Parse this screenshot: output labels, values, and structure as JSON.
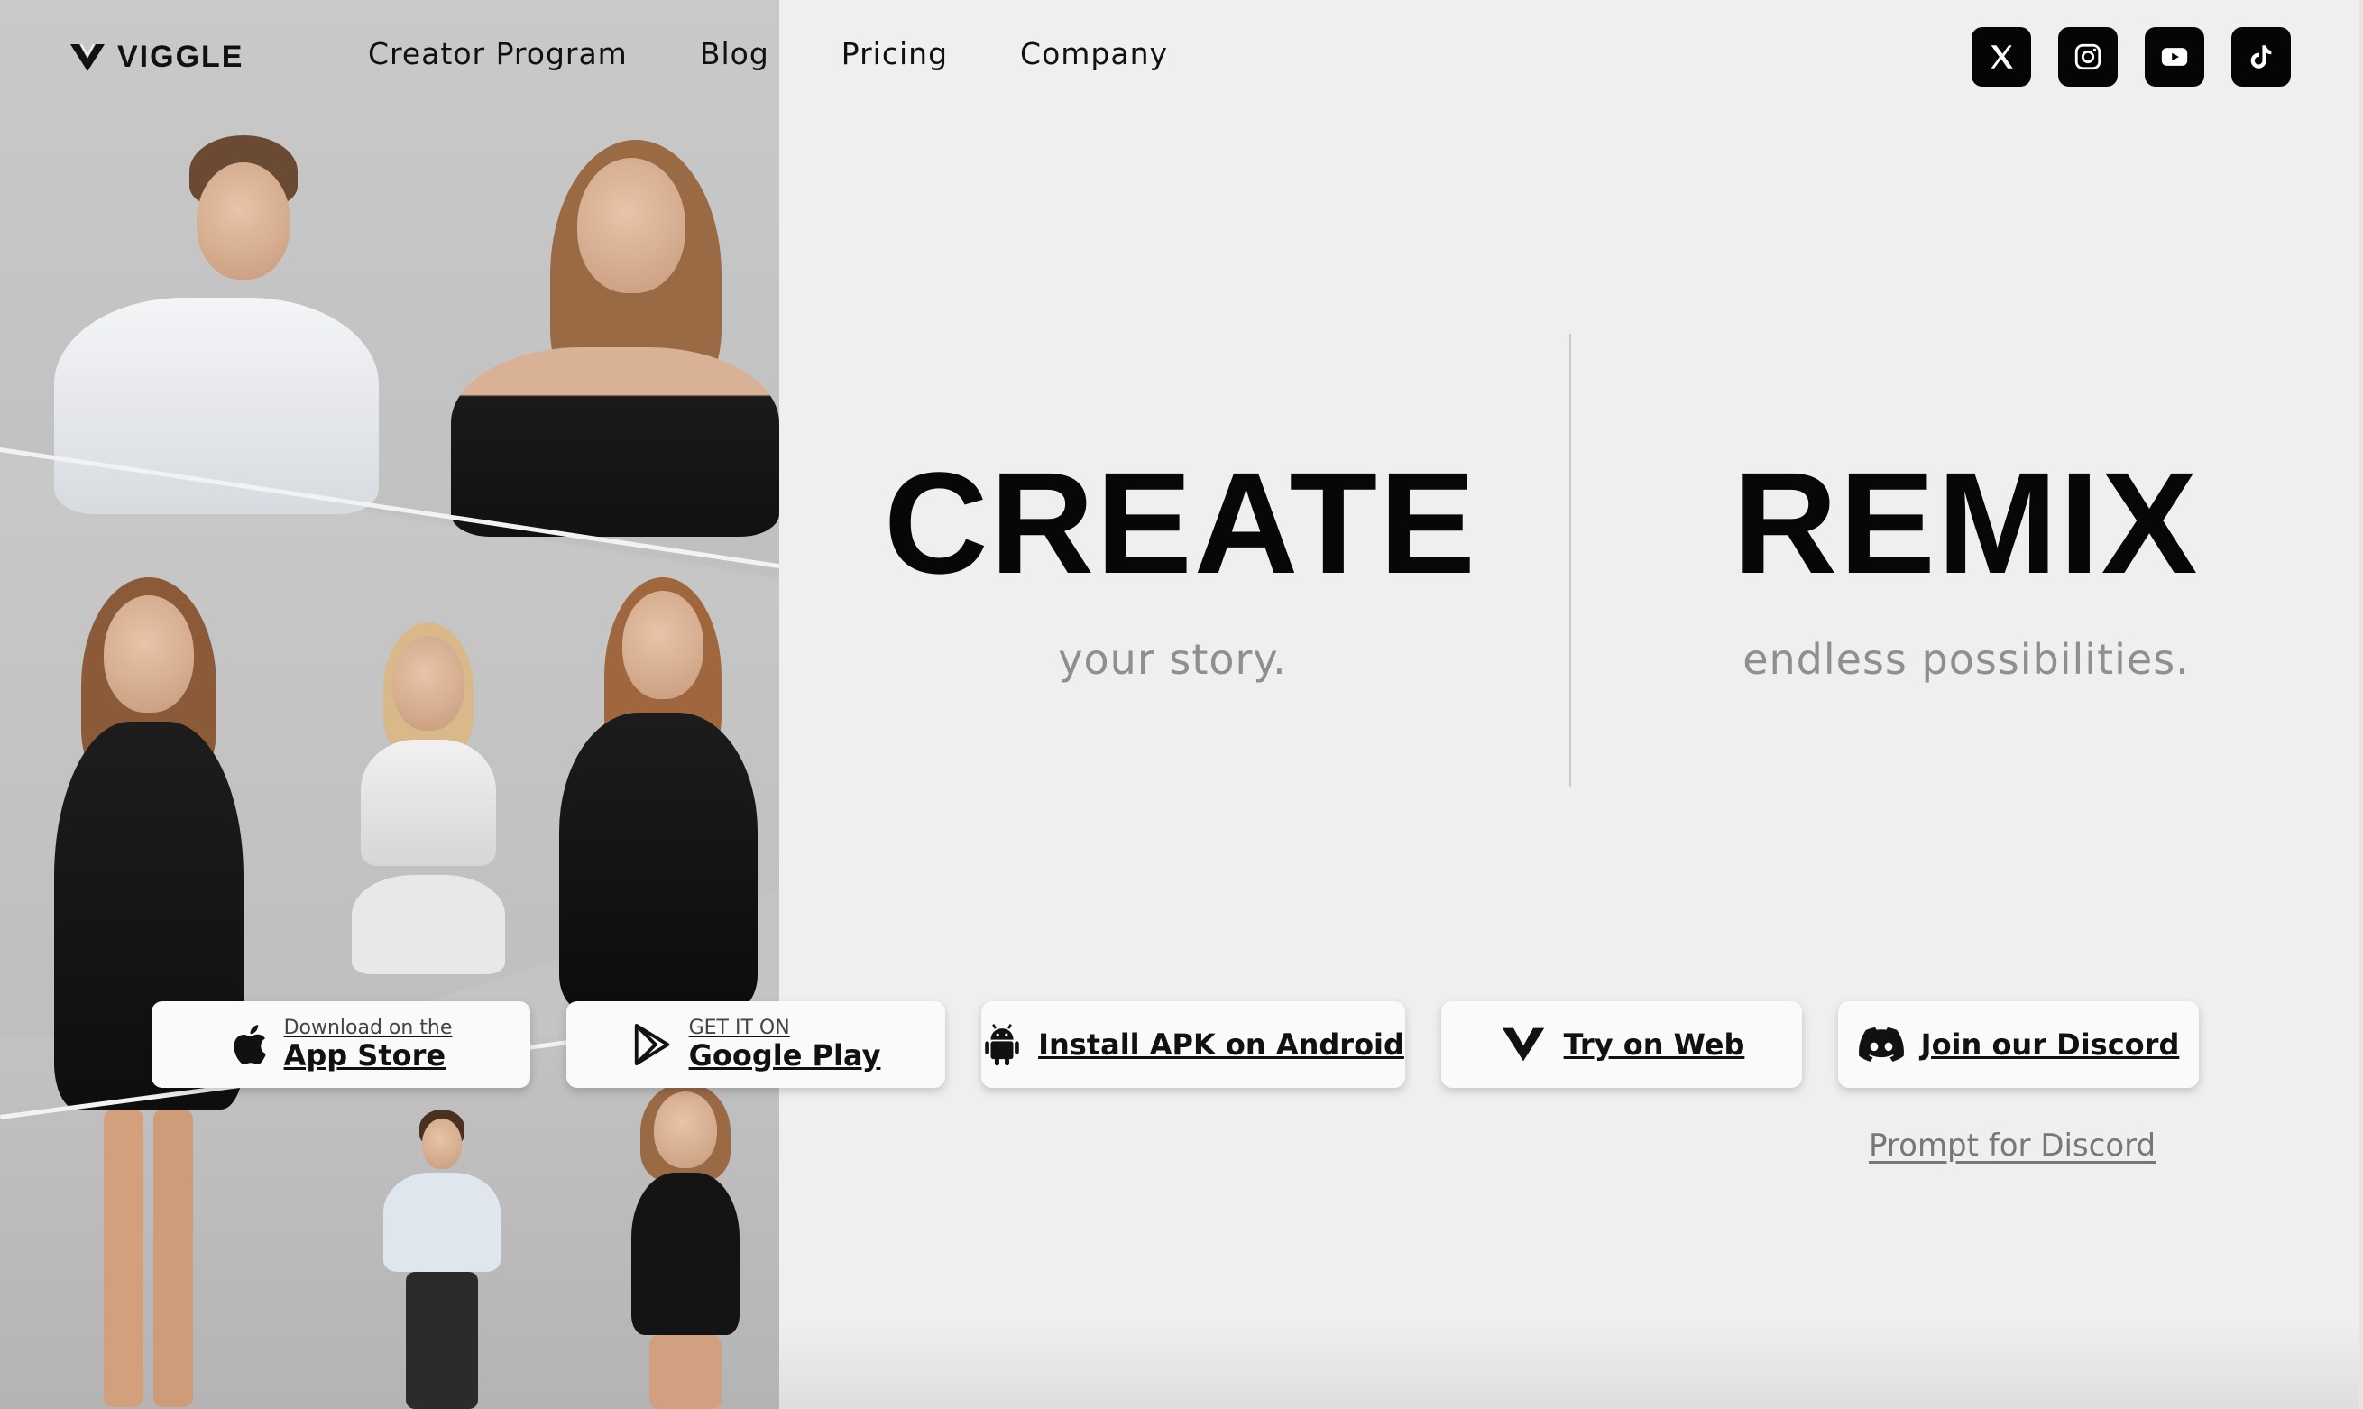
{
  "brand": {
    "name": "VIGGLE"
  },
  "nav": {
    "items": [
      {
        "label": "Creator Program"
      },
      {
        "label": "Blog"
      },
      {
        "label": "Pricing"
      },
      {
        "label": "Company"
      }
    ]
  },
  "socials": [
    {
      "icon": "x-icon",
      "label": "X"
    },
    {
      "icon": "instagram-icon",
      "label": "Instagram"
    },
    {
      "icon": "youtube-icon",
      "label": "YouTube"
    },
    {
      "icon": "tiktok-icon",
      "label": "TikTok"
    }
  ],
  "hero": {
    "create": {
      "title": "CREATE",
      "subtitle": "your story."
    },
    "remix": {
      "title": "REMIX",
      "subtitle": "endless possibilities."
    }
  },
  "cta": {
    "appstore": {
      "small": "Download on the",
      "big": "App Store"
    },
    "googleplay": {
      "small": "GET IT ON",
      "big": "Google Play"
    },
    "apk": {
      "label": "Install APK on Android"
    },
    "web": {
      "label": "Try on Web"
    },
    "discord": {
      "label": "Join our Discord"
    },
    "prompt_link": "Prompt for Discord"
  },
  "colors": {
    "background": "#efefef",
    "text": "#111111",
    "muted": "#8f8f8f",
    "social_bg": "#050505",
    "button_bg": "#fafafa"
  }
}
